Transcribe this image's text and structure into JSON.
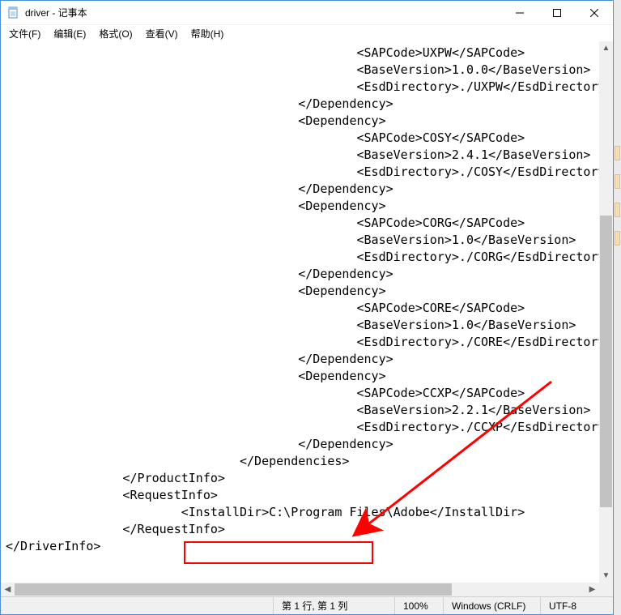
{
  "titlebar": {
    "title": "driver - 记事本"
  },
  "menu": {
    "file": "文件(F)",
    "edit": "编辑(E)",
    "format": "格式(O)",
    "view": "查看(V)",
    "help": "帮助(H)"
  },
  "content_lines": [
    "                                                <SAPCode>UXPW</SAPCode>",
    "                                                <BaseVersion>1.0.0</BaseVersion>",
    "                                                <EsdDirectory>./UXPW</EsdDirectory>",
    "                                        </Dependency>",
    "                                        <Dependency>",
    "                                                <SAPCode>COSY</SAPCode>",
    "                                                <BaseVersion>2.4.1</BaseVersion>",
    "                                                <EsdDirectory>./COSY</EsdDirectory>",
    "                                        </Dependency>",
    "                                        <Dependency>",
    "                                                <SAPCode>CORG</SAPCode>",
    "                                                <BaseVersion>1.0</BaseVersion>",
    "                                                <EsdDirectory>./CORG</EsdDirectory>",
    "                                        </Dependency>",
    "                                        <Dependency>",
    "                                                <SAPCode>CORE</SAPCode>",
    "                                                <BaseVersion>1.0</BaseVersion>",
    "                                                <EsdDirectory>./CORE</EsdDirectory>",
    "                                        </Dependency>",
    "                                        <Dependency>",
    "                                                <SAPCode>CCXP</SAPCode>",
    "                                                <BaseVersion>2.2.1</BaseVersion>",
    "                                                <EsdDirectory>./CCXP</EsdDirectory>",
    "                                        </Dependency>",
    "                                </Dependencies>",
    "                </ProductInfo>",
    "                <RequestInfo>",
    "                        <InstallDir>C:\\Program Files\\Adobe</InstallDir>",
    "                </RequestInfo>",
    "</DriverInfo>"
  ],
  "statusbar": {
    "pos": "第 1 行, 第 1 列",
    "zoom": "100%",
    "lineend": "Windows (CRLF)",
    "encoding": "UTF-8"
  },
  "icons": {
    "minimize": "minimize-icon",
    "maximize": "maximize-icon",
    "close": "close-icon",
    "notepad": "notepad-icon"
  },
  "annotation": {
    "color": "#ff0000",
    "highlight_target": "C:\\Program Files\\Adobe"
  }
}
